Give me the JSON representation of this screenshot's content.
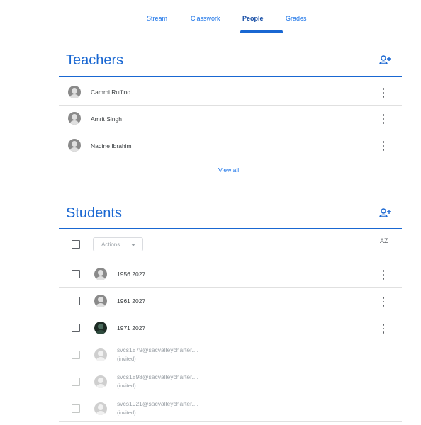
{
  "tabs": [
    {
      "label": "Stream"
    },
    {
      "label": "Classwork"
    },
    {
      "label": "People",
      "active": true
    },
    {
      "label": "Grades"
    }
  ],
  "teachers": {
    "title": "Teachers",
    "people": [
      {
        "name": "Cammi Ruffino"
      },
      {
        "name": "Amrit Singh"
      },
      {
        "name": "Nadine Ibrahim"
      }
    ],
    "view_all": "View all"
  },
  "students": {
    "title": "Students",
    "actions_label": "Actions",
    "sort_label": "AZ",
    "people": [
      {
        "name": "1956 2027",
        "invited": false,
        "avatar": "default"
      },
      {
        "name": "1961 2027",
        "invited": false,
        "avatar": "default"
      },
      {
        "name": "1971 2027",
        "invited": false,
        "avatar": "photo"
      },
      {
        "name": "svcs1879@sacvalleycharter....",
        "status": "(invited)",
        "invited": true
      },
      {
        "name": "svcs1898@sacvalleycharter....",
        "status": "(invited)",
        "invited": true
      },
      {
        "name": "svcs1921@sacvalleycharter....",
        "status": "(invited)",
        "invited": true
      }
    ]
  },
  "colors": {
    "accent": "#1967d2",
    "link": "#1a73e8",
    "text": "#3c4043",
    "muted": "#9aa0a6",
    "divider": "#e0e0e0"
  },
  "icons": {
    "add_person": "person-add-icon",
    "more": "more-vert-icon",
    "sort": "sort-az-icon",
    "dropdown": "arrow-drop-down-icon"
  }
}
